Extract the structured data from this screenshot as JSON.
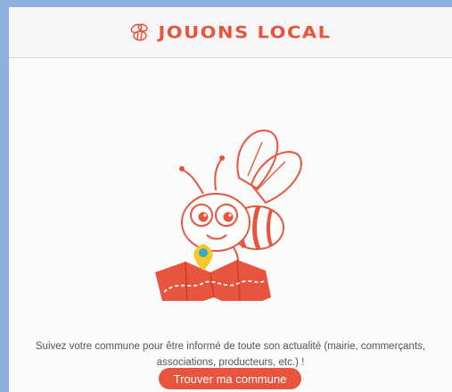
{
  "header": {
    "logo_text": "JOUONS LOCAL",
    "logo_icon": "bee-icon"
  },
  "main": {
    "illustration_icon": "bee-on-map-icon",
    "message": "Suivez votre commune pour être informé de toute son actualité (mairie, commerçants, associations, producteurs, etc.) !",
    "cta_label": "Trouver ma commune"
  },
  "colors": {
    "accent": "#e8553e",
    "page_background": "#8faee0",
    "header_background": "#f6f6f6",
    "pin": "#f4c92a",
    "pin_center": "#3aa7c9"
  }
}
